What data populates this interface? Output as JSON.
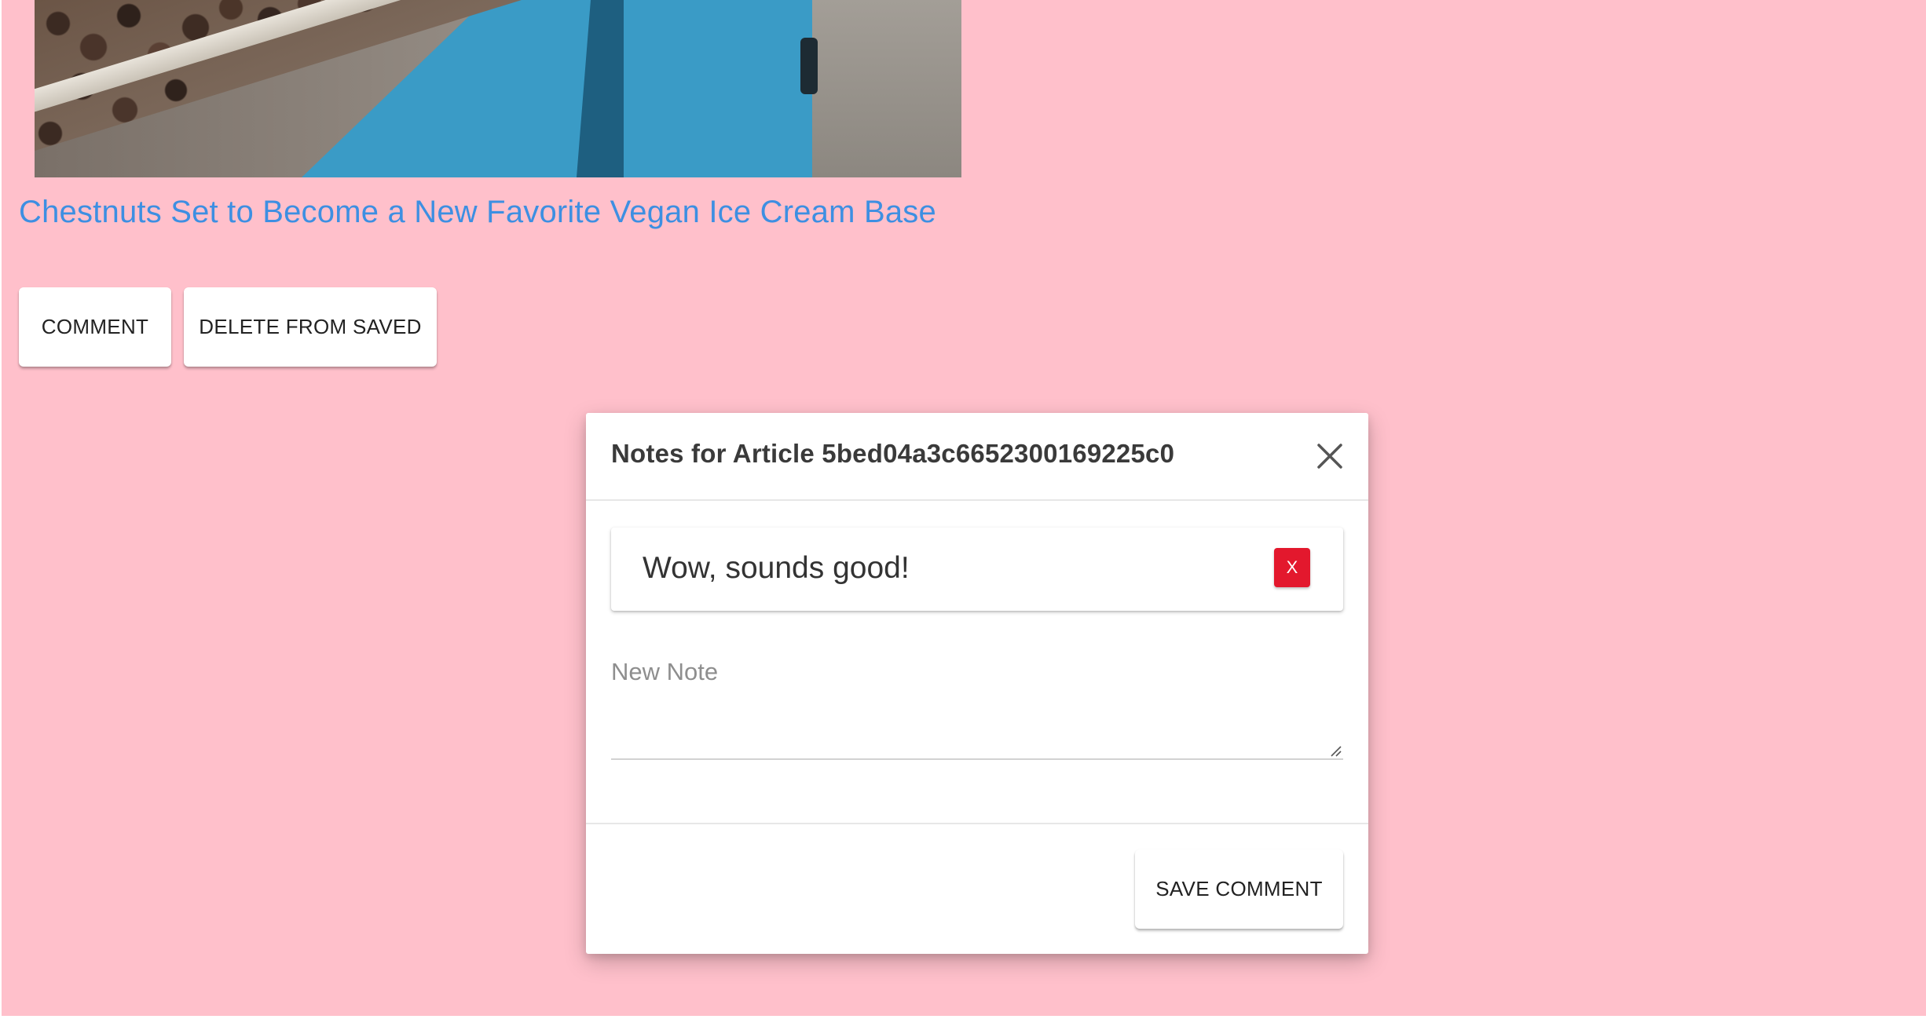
{
  "article": {
    "title": "Chestnuts Set to Become a New Favorite Vegan Ice Cream Base"
  },
  "actions": {
    "comment_label": "COMMENT",
    "delete_label": "DELETE FROM SAVED"
  },
  "modal": {
    "title": "Notes for Article 5bed04a3c6652300169225c0",
    "close_icon": "close-icon",
    "notes": [
      {
        "text": "Wow, sounds good!",
        "delete_label": "X"
      }
    ],
    "new_note": {
      "placeholder": "New Note",
      "value": ""
    },
    "save_label": "SAVE COMMENT"
  },
  "colors": {
    "background": "#ffc0cb",
    "link": "#3d8fe2",
    "delete_note": "#e3182d"
  }
}
